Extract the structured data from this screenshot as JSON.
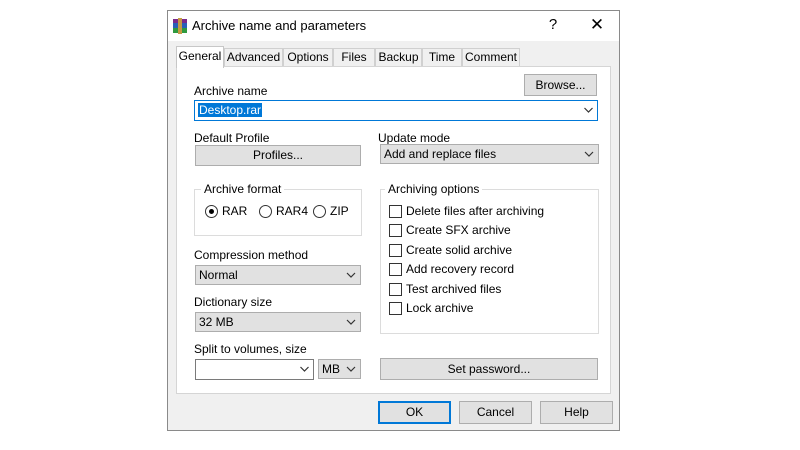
{
  "window": {
    "title": "Archive name and parameters",
    "help_symbol": "?",
    "close_symbol": "✕"
  },
  "tabs": [
    {
      "label": "General",
      "active": true
    },
    {
      "label": "Advanced"
    },
    {
      "label": "Options"
    },
    {
      "label": "Files"
    },
    {
      "label": "Backup"
    },
    {
      "label": "Time"
    },
    {
      "label": "Comment"
    }
  ],
  "archive_name": {
    "label": "Archive name",
    "value": "Desktop.rar",
    "browse_label": "Browse..."
  },
  "default_profile": {
    "label": "Default Profile",
    "button_label": "Profiles..."
  },
  "update_mode": {
    "label": "Update mode",
    "value": "Add and replace files"
  },
  "archive_format": {
    "label": "Archive format",
    "options": [
      {
        "label": "RAR",
        "selected": true
      },
      {
        "label": "RAR4",
        "selected": false
      },
      {
        "label": "ZIP",
        "selected": false
      }
    ]
  },
  "archiving_options": {
    "label": "Archiving options",
    "items": [
      {
        "label": "Delete files after archiving",
        "checked": false
      },
      {
        "label": "Create SFX archive",
        "checked": false
      },
      {
        "label": "Create solid archive",
        "checked": false
      },
      {
        "label": "Add recovery record",
        "checked": false
      },
      {
        "label": "Test archived files",
        "checked": false
      },
      {
        "label": "Lock archive",
        "checked": false
      }
    ]
  },
  "compression_method": {
    "label": "Compression method",
    "value": "Normal"
  },
  "dictionary_size": {
    "label": "Dictionary size",
    "value": "32 MB"
  },
  "split_volumes": {
    "label": "Split to volumes, size",
    "value": "",
    "unit": "MB"
  },
  "set_password": {
    "label": "Set password..."
  },
  "footer": {
    "ok": "OK",
    "cancel": "Cancel",
    "help": "Help"
  },
  "colors": {
    "accent": "#0078d7",
    "button_face": "#e1e1e1",
    "dialog_bg": "#f0f0f0"
  }
}
